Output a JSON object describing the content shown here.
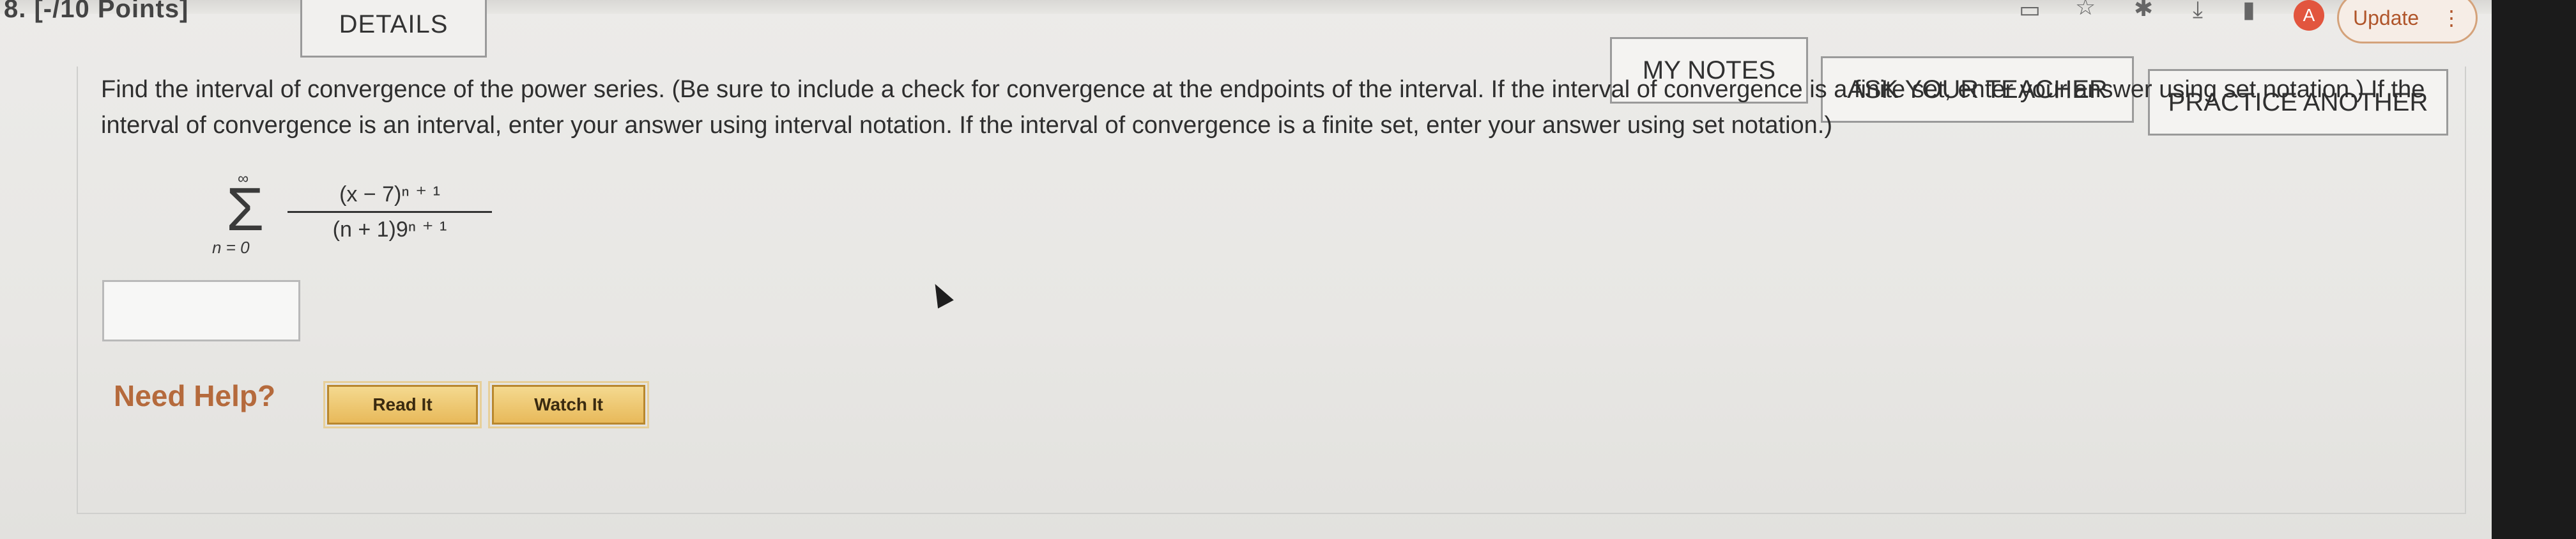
{
  "header": {
    "question_number": "8.  [-/10 Points]",
    "details_label": "DETAILS",
    "my_notes_label": "MY NOTES",
    "ask_teacher_label": "ASK YOUR TEACHER",
    "practice_label": "PRACTICE ANOTHER"
  },
  "browser": {
    "avatar_letter": "A",
    "update_label": "Update",
    "menu_glyph": "⋮"
  },
  "question": {
    "text": "Find the interval of convergence of the power series. (Be sure to include a check for convergence at the endpoints of the interval. If the interval of convergence is a finite set, enter your answer using set notation.) If the interval of convergence is an interval, enter your answer using interval notation. If the interval of convergence is a finite set, enter your answer using set notation.)",
    "sum_upper": "∞",
    "sum_lower": "n = 0",
    "numerator": "(x − 7)ⁿ ⁺ ¹",
    "denominator": "(n + 1)9ⁿ ⁺ ¹"
  },
  "answer": {
    "value": ""
  },
  "help": {
    "label": "Need Help?",
    "read_it": "Read It",
    "watch_it": "Watch It"
  }
}
